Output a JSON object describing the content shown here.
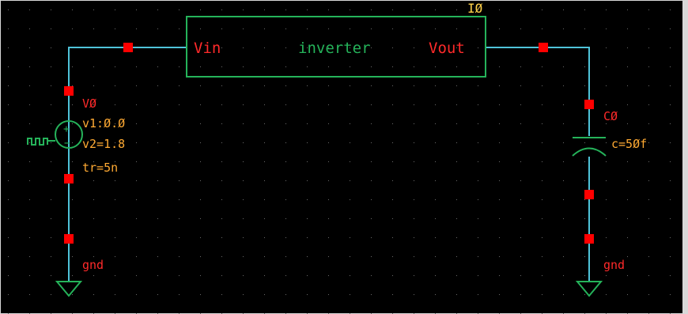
{
  "colors": {
    "background": "#000000",
    "grid_dot": "#6a6a6a",
    "wire": "#4fc3d9",
    "pin": "#ff0000",
    "block": "#25b35a",
    "pin_label": "#ff2a2a",
    "instance_label": "#ffd24a",
    "symbol": "#25b35a",
    "param_text": "#ffaa33",
    "gnd_label": "#ff2a2a",
    "window_border": "#d8d8d8"
  },
  "instance": {
    "name": "IØ",
    "cell": "inverter",
    "pins": {
      "in": "Vin",
      "out": "Vout"
    }
  },
  "vsource": {
    "name": "VØ",
    "params": [
      "v1:Ø.Ø",
      "v2=1.8",
      "tr=5n"
    ],
    "icon": "pulse-source-icon"
  },
  "capacitor": {
    "name": "CØ",
    "params": [
      "c=5Øf"
    ],
    "icon": "capacitor-icon"
  },
  "grounds": [
    {
      "label": "gnd",
      "icon": "ground-icon"
    },
    {
      "label": "gnd",
      "icon": "ground-icon"
    }
  ]
}
